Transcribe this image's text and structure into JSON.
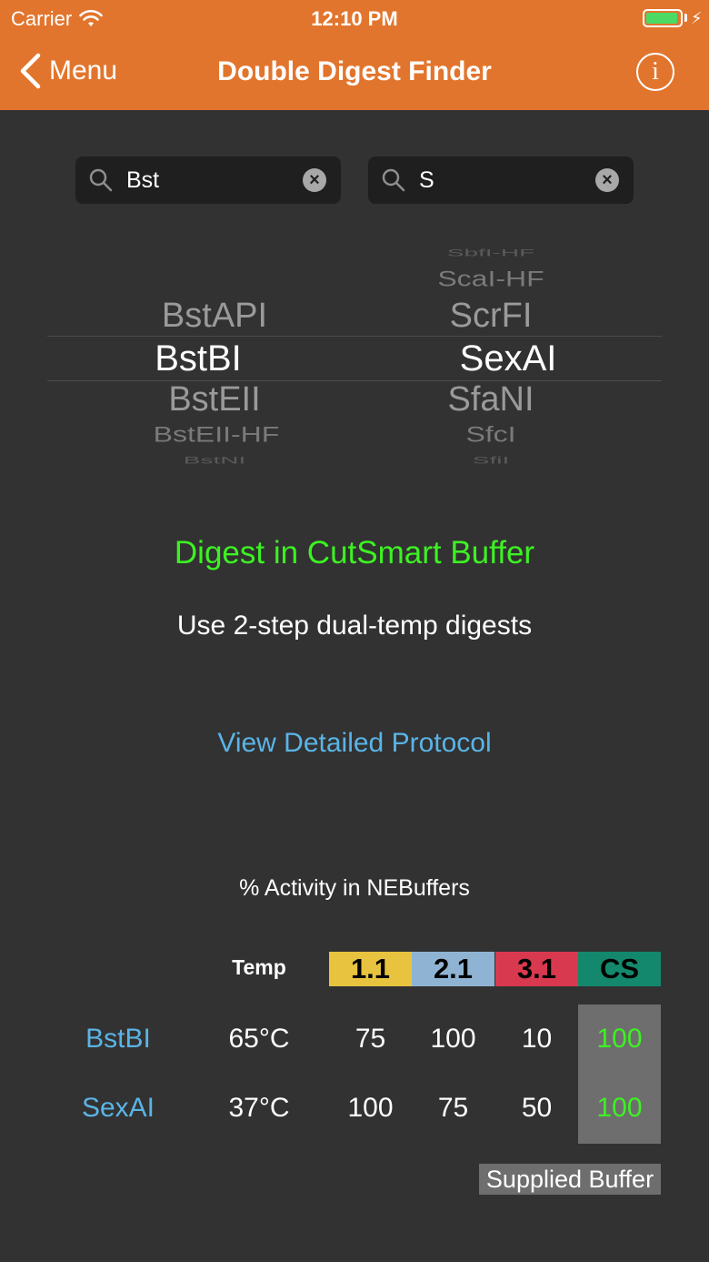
{
  "status_bar": {
    "carrier": "Carrier",
    "time": "12:10 PM"
  },
  "nav": {
    "back_label": "Menu",
    "title": "Double Digest Finder",
    "info_glyph": "i"
  },
  "search": {
    "left": {
      "value": "Bst"
    },
    "right": {
      "value": "S"
    }
  },
  "picker_left": {
    "above_far": "BstAPI",
    "selected": "BstBI",
    "below_1": "BstEII",
    "below_2": "BstEII-HF",
    "below_3": "BstNI"
  },
  "picker_right": {
    "above_3": "SbfI-HF",
    "above_2": "ScaI-HF",
    "above_1": "ScrFI",
    "selected": "SexAI",
    "below_1": "SfaNI",
    "below_2": "SfcI",
    "below_3": "SfiI"
  },
  "result": {
    "buffer_text": "Digest in CutSmart Buffer",
    "instruction": "Use 2-step dual-temp digests",
    "protocol_link": "View Detailed Protocol"
  },
  "activity": {
    "title": "% Activity in NEBuffers",
    "temp_header": "Temp",
    "buffers": [
      {
        "label": "1.1",
        "color": "#e7c33f"
      },
      {
        "label": "2.1",
        "color": "#8fb4d3"
      },
      {
        "label": "3.1",
        "color": "#d9394f"
      },
      {
        "label": "CS",
        "color": "#13886c"
      }
    ],
    "rows": [
      {
        "enzyme": "BstBI",
        "temp": "65°C",
        "values": [
          "75",
          "100",
          "10",
          "100"
        ]
      },
      {
        "enzyme": "SexAI",
        "temp": "37°C",
        "values": [
          "100",
          "75",
          "50",
          "100"
        ]
      }
    ],
    "supplied_label": "Supplied Buffer",
    "supplied_color": "#3df123"
  },
  "colors": {
    "accent": "#e2752d",
    "link": "#5ab4e6",
    "background": "#323232"
  }
}
